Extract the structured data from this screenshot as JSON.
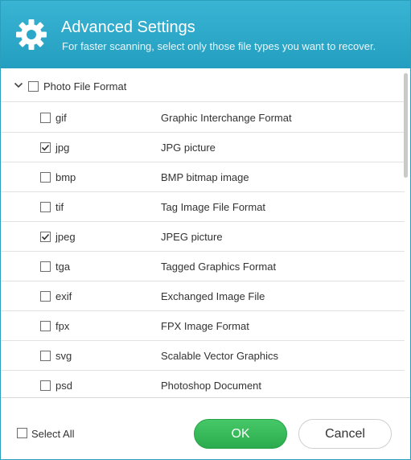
{
  "header": {
    "title": "Advanced Settings",
    "subtitle": "For faster scanning, select only those file types you want to recover."
  },
  "group": {
    "label": "Photo File Format",
    "checked": false,
    "expanded": true
  },
  "file_types": [
    {
      "ext": "gif",
      "desc": "Graphic Interchange Format",
      "checked": false
    },
    {
      "ext": "jpg",
      "desc": "JPG picture",
      "checked": true
    },
    {
      "ext": "bmp",
      "desc": "BMP bitmap image",
      "checked": false
    },
    {
      "ext": "tif",
      "desc": "Tag Image File Format",
      "checked": false
    },
    {
      "ext": "jpeg",
      "desc": "JPEG picture",
      "checked": true
    },
    {
      "ext": "tga",
      "desc": "Tagged Graphics Format",
      "checked": false
    },
    {
      "ext": "exif",
      "desc": "Exchanged Image File",
      "checked": false
    },
    {
      "ext": "fpx",
      "desc": "FPX Image Format",
      "checked": false
    },
    {
      "ext": "svg",
      "desc": "Scalable Vector Graphics",
      "checked": false
    },
    {
      "ext": "psd",
      "desc": "Photoshop Document",
      "checked": false
    }
  ],
  "footer": {
    "select_all_label": "Select All",
    "select_all_checked": false,
    "ok_label": "OK",
    "cancel_label": "Cancel"
  },
  "colors": {
    "header": "#2aa8c9",
    "ok_button": "#35b957"
  }
}
